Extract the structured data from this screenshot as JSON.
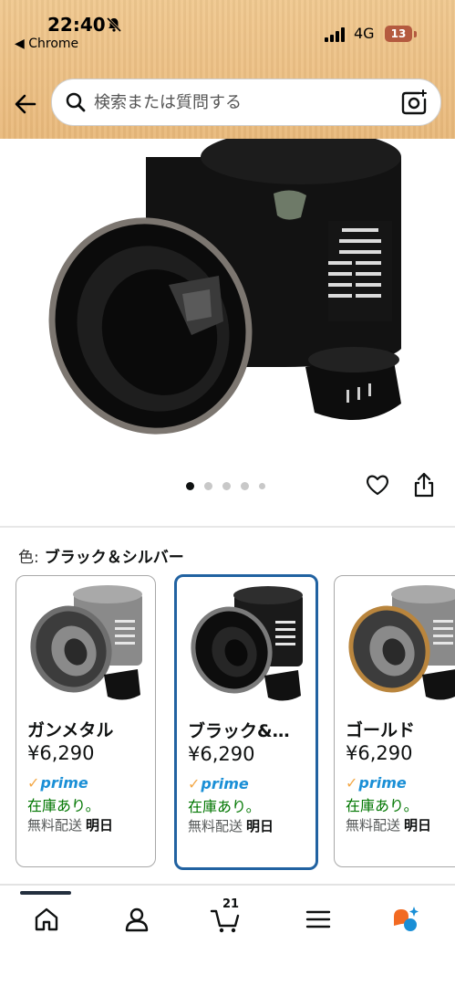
{
  "status_bar": {
    "time": "22:40",
    "back_app": "◀ Chrome",
    "network": "4G",
    "battery": "13"
  },
  "search": {
    "placeholder": "検索または質問する"
  },
  "gallery": {
    "dot_count": 5,
    "active_dot": 1
  },
  "variation": {
    "label": "色:",
    "selected": "ブラック＆シルバー"
  },
  "cards": [
    {
      "name": "ガンメタル",
      "price": "¥6,290",
      "prime": "prime",
      "stock": "在庫あり。",
      "ship_label": "無料配送",
      "ship_day": "明日",
      "rim_color": "#6e6e6e",
      "body_color": "#8a8a8a"
    },
    {
      "name": "ブラック&…",
      "price": "¥6,290",
      "prime": "prime",
      "stock": "在庫あり。",
      "ship_label": "無料配送",
      "ship_day": "明日",
      "rim_color": "#7a7a7a",
      "body_color": "#1a1a1a"
    },
    {
      "name": "ゴールド",
      "price": "¥6,290",
      "prime": "prime",
      "stock": "在庫あり。",
      "ship_label": "無料配送",
      "ship_day": "明日",
      "rim_color": "#b9853d",
      "body_color": "#8a8a8a"
    }
  ],
  "bottom_nav": {
    "cart_count": "21",
    "items": [
      "home-icon",
      "account-icon",
      "cart-icon",
      "menu-icon",
      "rufus-icon"
    ]
  },
  "colors": {
    "header_bg": "#eec38a",
    "selected_border": "#2162a1",
    "stock_green": "#007600",
    "prime_blue": "#1a8fd6"
  }
}
